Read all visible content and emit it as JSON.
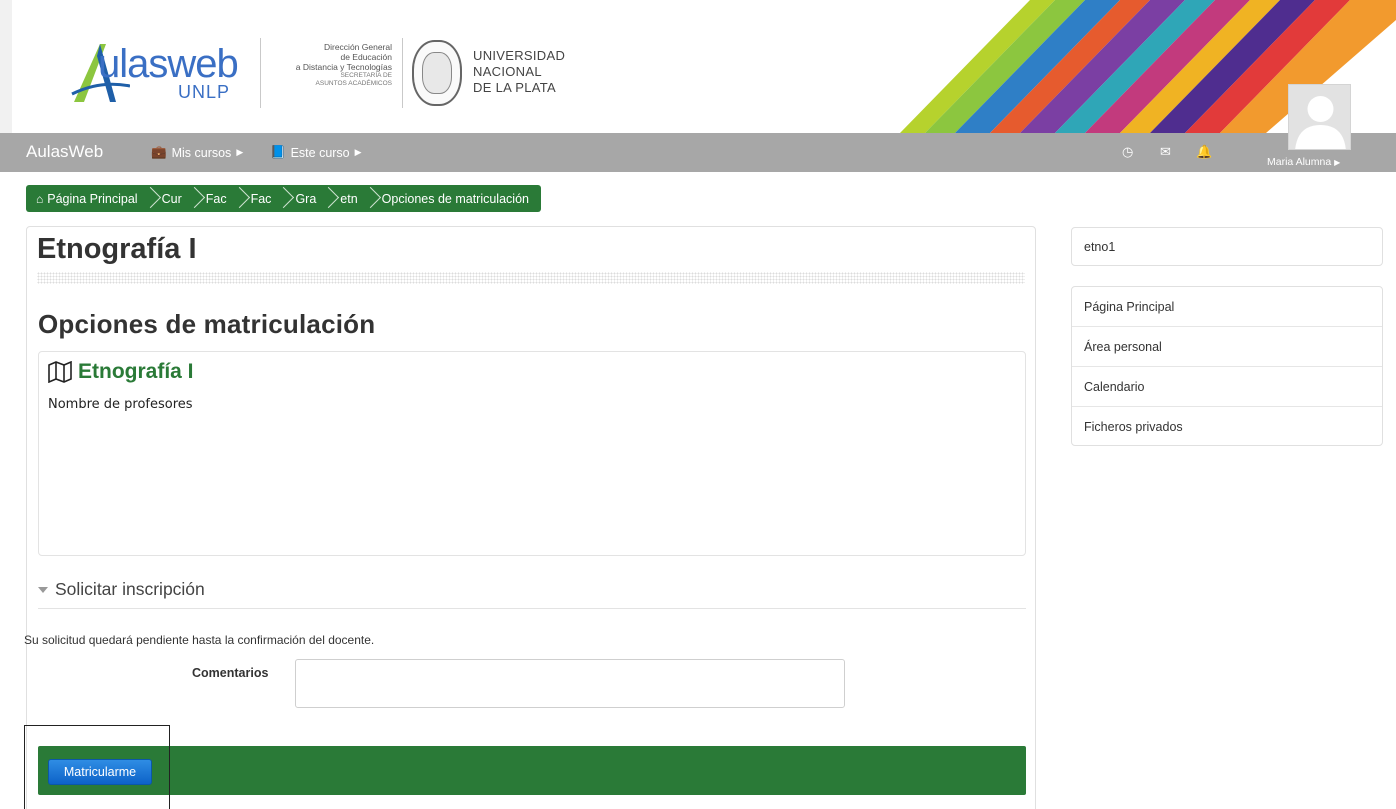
{
  "header": {
    "logo_word": "ulasweb",
    "logo_sub": "UNLP",
    "direction": {
      "line1": "Dirección General",
      "line2": "de Educación",
      "line3": "a Distancia y Tecnologías",
      "line4": "SECRETARÍA DE",
      "line5": "ASUNTOS ACADÉMICOS"
    },
    "university": {
      "line1": "UNIVERSIDAD",
      "line2": "NACIONAL",
      "line3": "DE LA PLATA"
    },
    "stripe_colors": [
      "#b6d22d",
      "#2f7fc6",
      "#7b3fa3",
      "#e65b2e",
      "#2fa6b7",
      "#c23a7d",
      "#f0b323",
      "#4f2d8f",
      "#e23a3a"
    ]
  },
  "navbar": {
    "brand": "AulasWeb",
    "my_courses": "Mis cursos",
    "this_course": "Este curso",
    "user_name": "Maria Alumna"
  },
  "breadcrumb": {
    "home": "Página Principal",
    "items": [
      "Cur",
      "Fac",
      "Fac",
      "Gra",
      "etn",
      "Opciones de matriculación"
    ]
  },
  "main": {
    "course_title": "Etnografía I",
    "section_title": "Opciones de matriculación",
    "course_link": "Etnografía I",
    "teachers_label": "Nombre de profesores",
    "legend": "Solicitar inscripción",
    "notice": "Su solicitud quedará pendiente hasta la confirmación del docente.",
    "comments_label": "Comentarios",
    "comments_value": "",
    "enrol_button": "Matricularme"
  },
  "sidebar": {
    "course_shortname": "etno1",
    "nav": [
      "Página Principal",
      "Área personal",
      "Calendario",
      "Ficheros privados"
    ]
  },
  "colors": {
    "theme_green": "#2a7a37",
    "navbar_gray": "#a7a7a7",
    "button_blue": "#0d62c8"
  }
}
